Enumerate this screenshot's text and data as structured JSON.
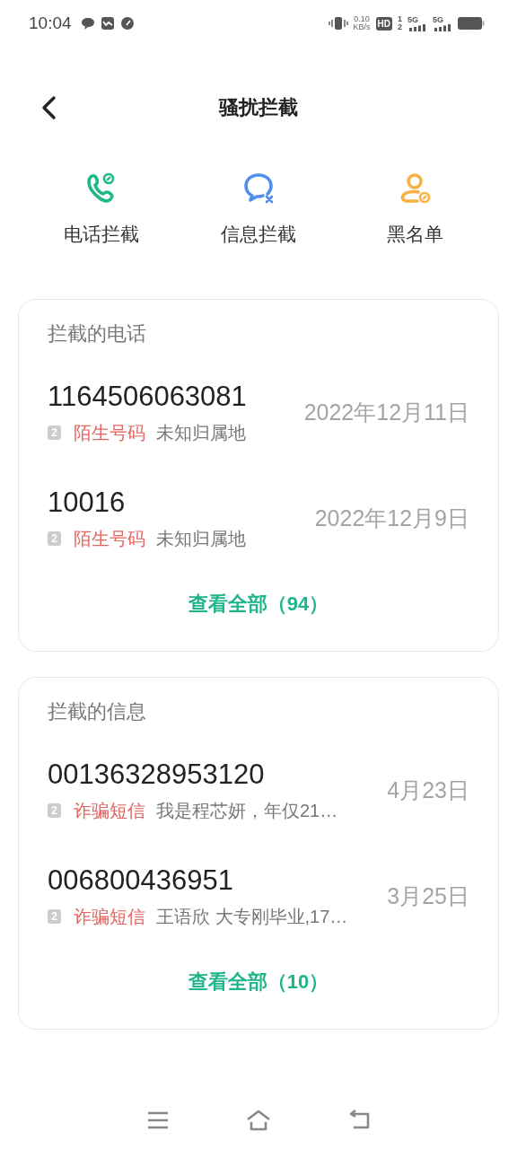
{
  "status_bar": {
    "time": "10:04",
    "speed_value": "0.10",
    "speed_unit": "KB/s",
    "hd_label": "HD",
    "sim_slots": [
      "1",
      "2"
    ],
    "networks": [
      "5G",
      "5G"
    ]
  },
  "header": {
    "title": "骚扰拦截"
  },
  "shortcuts": [
    {
      "kind": "call",
      "label": "电话拦截",
      "color": "#1fb989"
    },
    {
      "kind": "message",
      "label": "信息拦截",
      "color": "#4f8ef0"
    },
    {
      "kind": "contact",
      "label": "黑名单",
      "color": "#f7b244"
    }
  ],
  "sections": [
    {
      "title": "拦截的电话",
      "items": [
        {
          "number": "1164506063081",
          "sim": "2",
          "tag": "陌生号码",
          "detail": "未知归属地",
          "date": "2022年12月11日"
        },
        {
          "number": "10016",
          "sim": "2",
          "tag": "陌生号码",
          "detail": "未知归属地",
          "date": "2022年12月9日"
        }
      ],
      "view_all": "查看全部（94）"
    },
    {
      "title": "拦截的信息",
      "items": [
        {
          "number": "00136328953120",
          "sim": "2",
          "tag": "诈骗短信",
          "detail": "我是程芯妍，年仅21…",
          "date": "4月23日"
        },
        {
          "number": "006800436951",
          "sim": "2",
          "tag": "诈骗短信",
          "detail": "王语欣 大专刚毕业,17…",
          "date": "3月25日"
        }
      ],
      "view_all": "查看全部（10）"
    }
  ]
}
